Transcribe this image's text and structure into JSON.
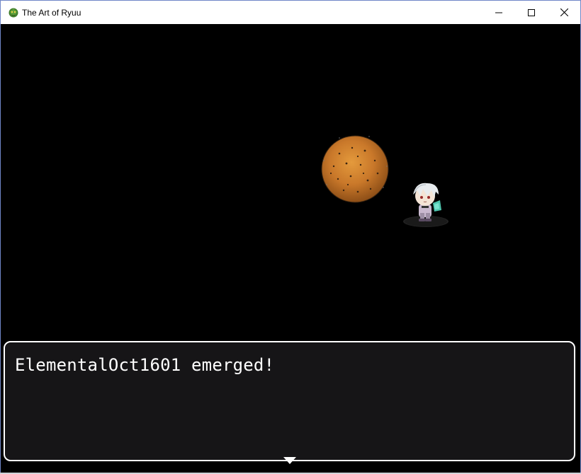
{
  "window": {
    "title": "The Art of Ryuu"
  },
  "game": {
    "enemy_name": "ElementalOct1601",
    "message": "ElementalOct1601 emerged!"
  },
  "icons": {
    "app": "dragon-app-icon",
    "minimize": "minimize-icon",
    "maximize": "maximize-icon",
    "close": "close-icon",
    "continue": "continue-arrow-icon"
  }
}
